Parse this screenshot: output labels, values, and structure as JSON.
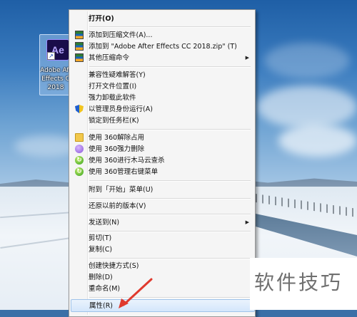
{
  "desktop": {
    "icon": {
      "logo_text": "Ae",
      "label_lines": [
        "Adobe Aft",
        "Effects C",
        "2018"
      ]
    }
  },
  "context_menu": {
    "items": [
      {
        "label": "打开(O)",
        "bold": true,
        "icon": "none"
      },
      {
        "label": "添加到压缩文件(A)...",
        "icon": "winrar-icon"
      },
      {
        "label": "添加到 \"Adobe After Effects CC 2018.zip\" (T)",
        "icon": "winrar-icon"
      },
      {
        "label": "其他压缩命令",
        "icon": "winrar-icon",
        "submenu": true
      },
      {
        "label": "兼容性疑难解答(Y)",
        "icon": "none"
      },
      {
        "label": "打开文件位置(I)",
        "icon": "none"
      },
      {
        "label": "强力卸载此软件",
        "icon": "none"
      },
      {
        "label": "以管理员身份运行(A)",
        "icon": "uac-shield-icon"
      },
      {
        "label": "锁定到任务栏(K)",
        "icon": "none"
      },
      {
        "label": "使用 360解除占用",
        "icon": "folder-icon"
      },
      {
        "label": "使用 360强力删除",
        "icon": "purple-360-icon"
      },
      {
        "label": "使用 360进行木马云查杀",
        "icon": "green-360-icon"
      },
      {
        "label": "使用 360管理右键菜单",
        "icon": "green-360-icon"
      },
      {
        "label": "附到「开始」菜单(U)",
        "icon": "none"
      },
      {
        "label": "还原以前的版本(V)",
        "icon": "none"
      },
      {
        "label": "发送到(N)",
        "icon": "none",
        "submenu": true
      },
      {
        "label": "剪切(T)",
        "icon": "none"
      },
      {
        "label": "复制(C)",
        "icon": "none"
      },
      {
        "label": "创建快捷方式(S)",
        "icon": "none"
      },
      {
        "label": "删除(D)",
        "icon": "none"
      },
      {
        "label": "重命名(M)",
        "icon": "none"
      },
      {
        "label": "属性(R)",
        "icon": "none",
        "highlighted": true
      }
    ],
    "submenu_arrow": "▶"
  },
  "watermark": {
    "text": "软件技巧"
  },
  "colors": {
    "arrow": "#e03a2e",
    "highlight": "#d4e6fb"
  }
}
